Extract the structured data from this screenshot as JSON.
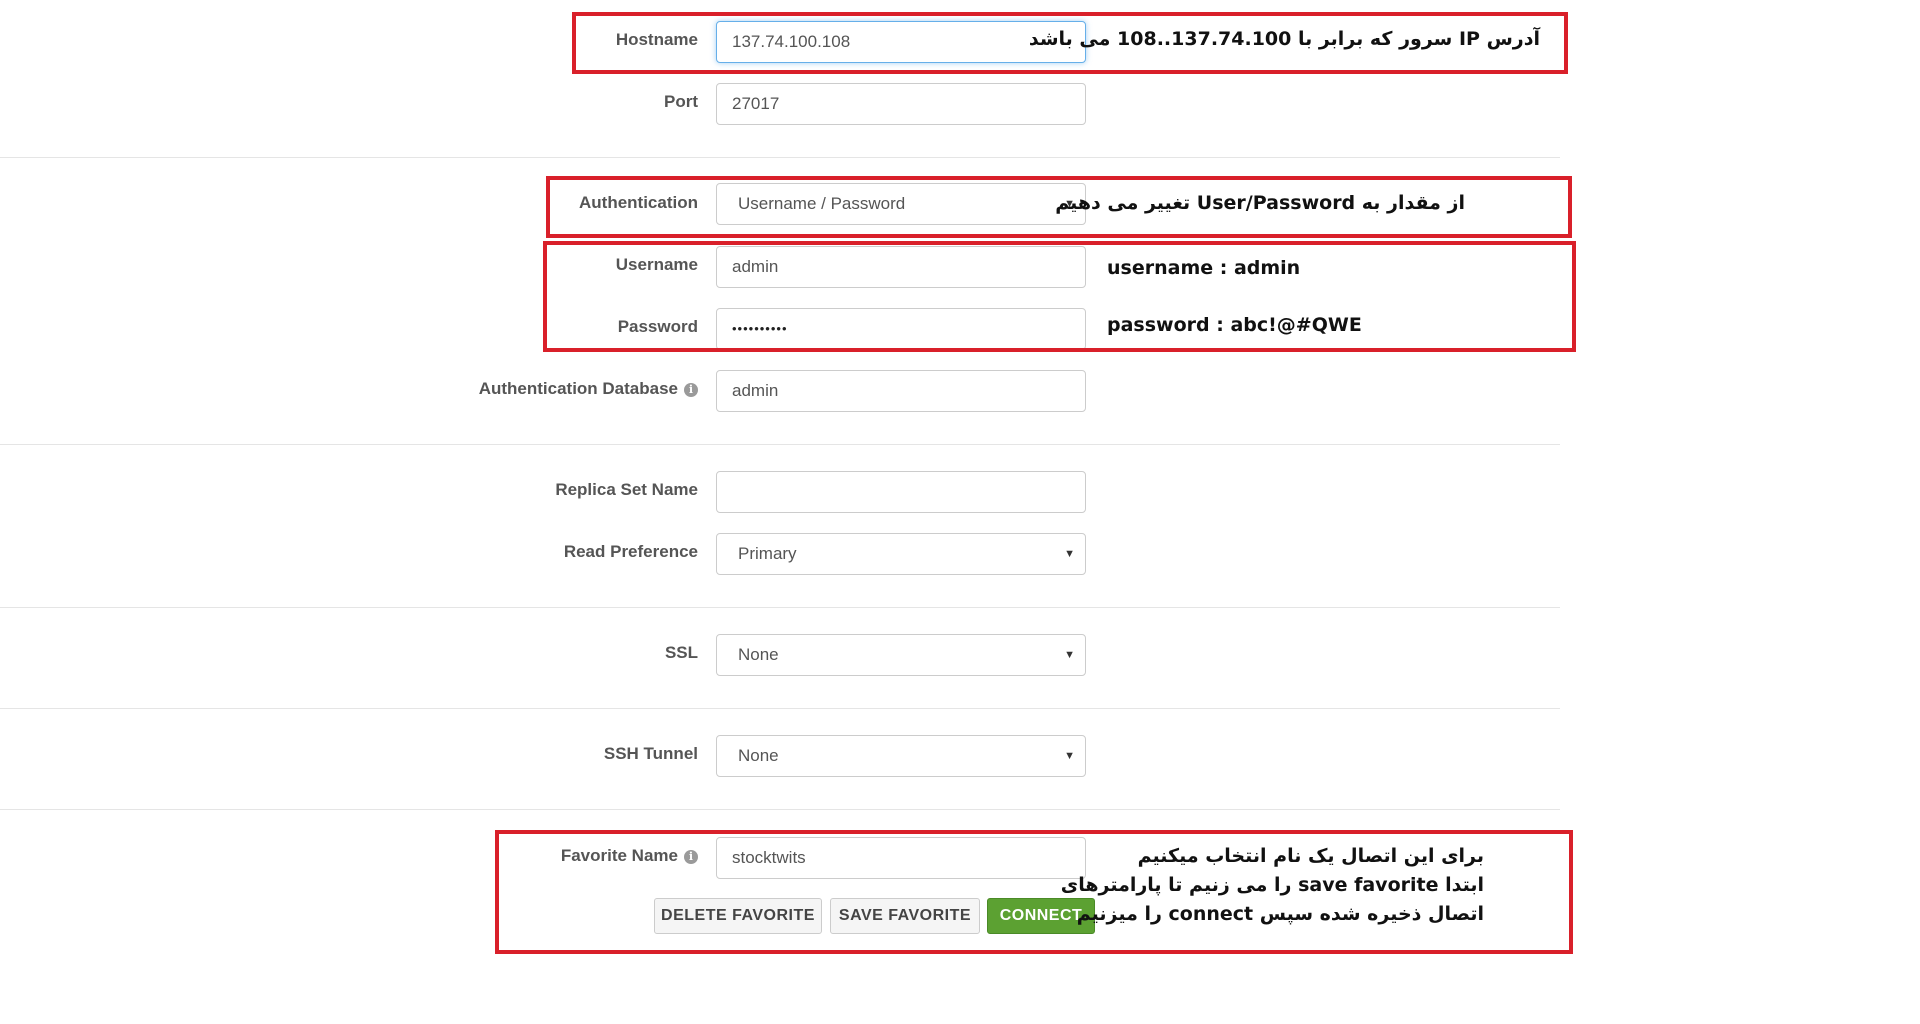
{
  "fields": {
    "hostname": {
      "label": "Hostname",
      "value": "137.74.100.108"
    },
    "port": {
      "label": "Port",
      "value": "27017"
    },
    "authentication": {
      "label": "Authentication",
      "value": "Username / Password"
    },
    "username": {
      "label": "Username",
      "value": "admin"
    },
    "password": {
      "label": "Password",
      "value": "••••••••••"
    },
    "auth_db": {
      "label": "Authentication Database",
      "value": "admin"
    },
    "replica_set": {
      "label": "Replica Set Name",
      "value": ""
    },
    "read_pref": {
      "label": "Read Preference",
      "value": "Primary"
    },
    "ssl": {
      "label": "SSL",
      "value": "None"
    },
    "ssh": {
      "label": "SSH Tunnel",
      "value": "None"
    },
    "favorite": {
      "label": "Favorite Name",
      "value": "stocktwits"
    }
  },
  "buttons": {
    "delete": "DELETE FAVORITE",
    "save": "SAVE FAVORITE",
    "connect": "CONNECT"
  },
  "annotations": {
    "hostname_note": "آدرس IP سرور که برابر با 137.74.100..108 می باشد",
    "auth_note": "از مقدار به User/Password تغییر می دهیم",
    "username_note": "username : admin",
    "password_note": "password : abc!@#QWE",
    "favorite_note_1": "برای این اتصال یک نام انتخاب میکنیم",
    "favorite_note_2": "ابتدا save favorite را می زنیم تا پارامترهای",
    "favorite_note_3": "اتصال ذخیره شده سپس connect را میزنیم"
  },
  "icons": {
    "dropdown": "caret-down-icon",
    "info": "info-icon"
  },
  "colors": {
    "highlight_box": "#d9202a",
    "connect_button": "#5ca132"
  }
}
